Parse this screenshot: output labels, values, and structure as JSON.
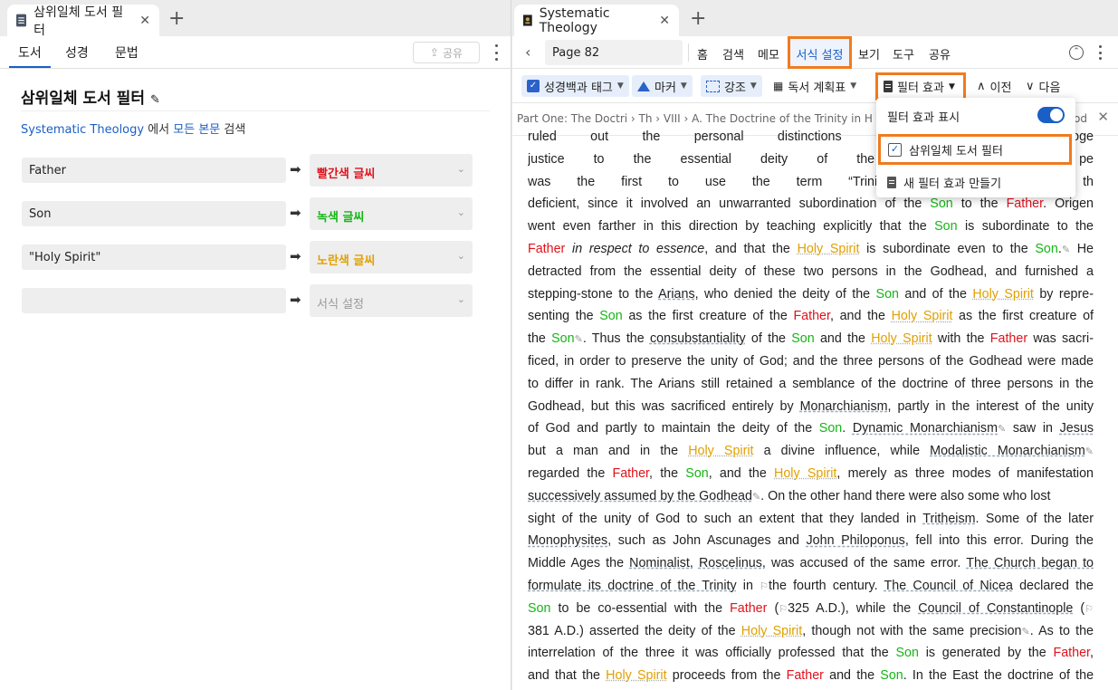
{
  "left_panel": {
    "tab_title": "삼위일체 도서 필터",
    "tabs": [
      "도서",
      "성경",
      "문법"
    ],
    "share_label": "공유",
    "heading": "삼위일체 도서 필터",
    "subtitle_book": "Systematic Theology",
    "subtitle_mid": " 에서 ",
    "subtitle_scope": "모든 본문",
    "subtitle_end": " 검색",
    "filters": [
      {
        "term": "Father",
        "style": "빨간색 글씨",
        "color": "#e0121b"
      },
      {
        "term": "Son",
        "style": "녹색 글씨",
        "color": "#15b515"
      },
      {
        "term": "\"Holy Spirit\"",
        "style": "노란색 글씨",
        "color": "#e0a000"
      },
      {
        "term": "",
        "style": "서식 설정",
        "color": "#999999"
      }
    ]
  },
  "right_panel": {
    "tab_title": "Systematic Theology",
    "page_field": "Page 82",
    "menu": [
      "홈",
      "검색",
      "메모",
      "서식 설정",
      "보기",
      "도구",
      "공유"
    ],
    "toolbar": {
      "encyclopedia_tag": "성경백과 태그",
      "marker": "마커",
      "highlight": "강조",
      "reading_plan": "독서 계획표",
      "filter_effects": "필터 효과",
      "prev": "이전",
      "next": "다음"
    },
    "breadcrumb": "Part One: The Doctri › Th › VIII › A. The Doctrine of the Trinity in H",
    "breadcrumb_tail": "od",
    "dropdown": {
      "show_label": "필터 효과 표시",
      "selected": "삼위일체 도서 필터",
      "new_filter": "새 필터 효과 만들기"
    }
  },
  "colors": {
    "accent": "#1a5fc6",
    "highlight_border": "#f07b1f"
  }
}
